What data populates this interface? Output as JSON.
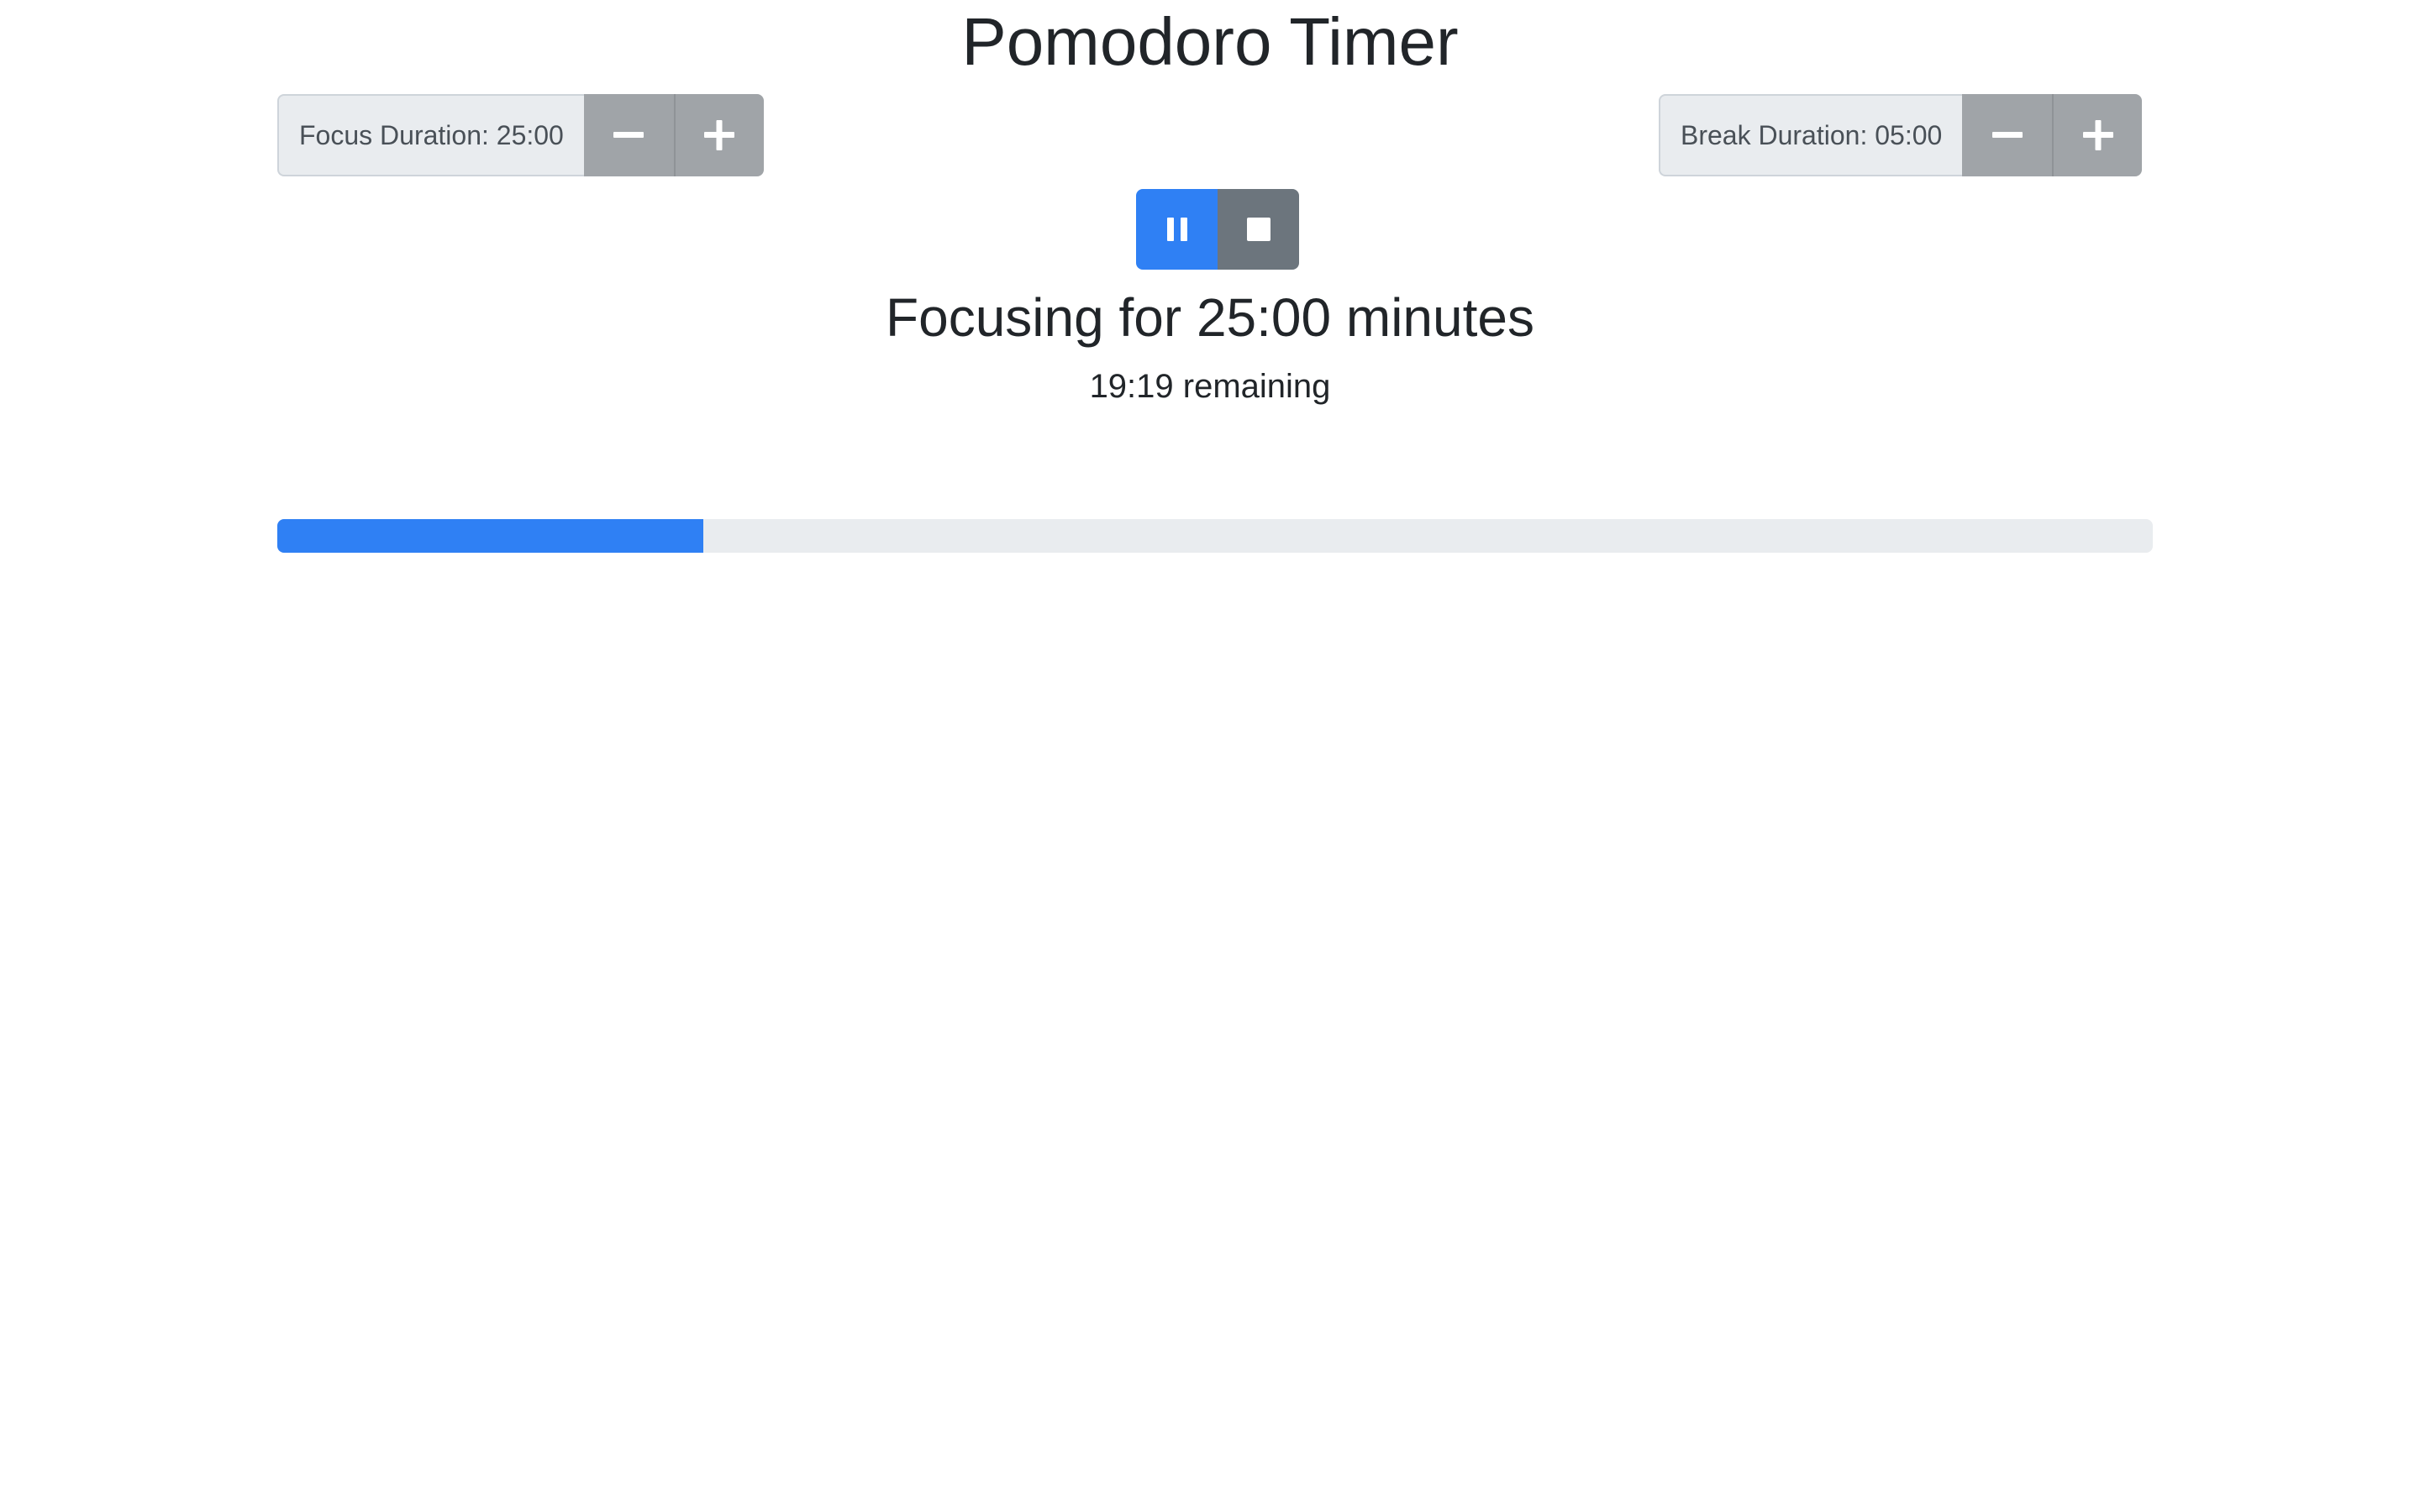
{
  "header": {
    "title": "Pomodoro Timer"
  },
  "focus": {
    "label": "Focus Duration: 25:00"
  },
  "break": {
    "label": "Break Duration: 05:00"
  },
  "controls": {
    "pause_icon": "pause-icon",
    "stop_icon": "stop-icon"
  },
  "timer": {
    "status": "Focusing for 25:00 minutes",
    "remaining": "19:19 remaining",
    "progress_fraction": 0.227
  },
  "colors": {
    "accent": "#2f80f4",
    "secondary": "#6c757d",
    "stepper": "#a0a4a8",
    "track": "#e9ecef"
  }
}
